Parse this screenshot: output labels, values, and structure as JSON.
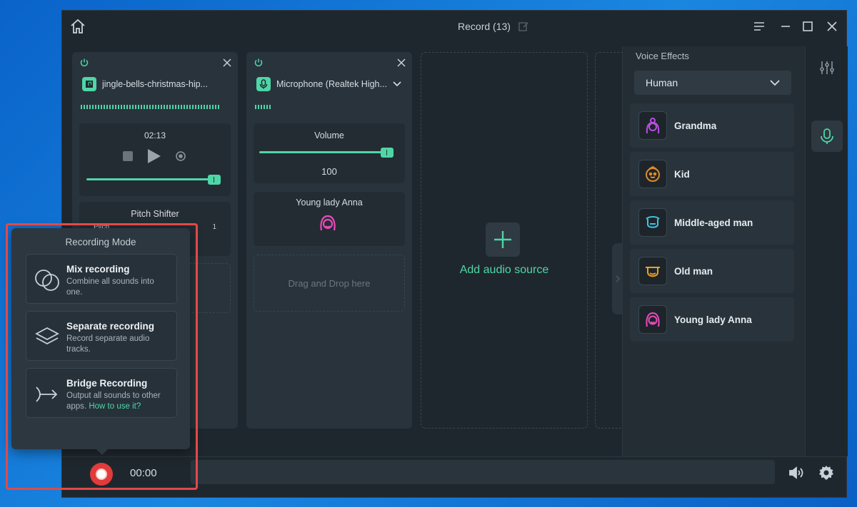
{
  "window": {
    "title": "Record (13)"
  },
  "card1": {
    "source_name": "jingle-bells-christmas-hip...",
    "time": "02:13",
    "pitch_title": "Pitch Shifter",
    "pitch_label": "Pitch",
    "pitch_value": "1"
  },
  "card2": {
    "source_name": "Microphone (Realtek High...",
    "volume_title": "Volume",
    "volume_value": "100",
    "effect_name": "Young lady Anna",
    "dropzone": "Drag and Drop here"
  },
  "add_source": {
    "label": "Add audio source"
  },
  "sidebar": {
    "title": "Voice Effects",
    "category": "Human",
    "effects": [
      {
        "label": "Grandma",
        "color": "#b84ee0"
      },
      {
        "label": "Kid",
        "color": "#e08a2a"
      },
      {
        "label": "Middle-aged man",
        "color": "#3fc4e0"
      },
      {
        "label": "Old man",
        "color": "#f0a020"
      },
      {
        "label": "Young lady Anna",
        "color": "#e84ab8"
      }
    ]
  },
  "recording_mode": {
    "title": "Recording Mode",
    "modes": [
      {
        "title": "Mix recording",
        "desc": "Combine all sounds into one."
      },
      {
        "title": "Separate recording",
        "desc": "Record separate audio tracks."
      },
      {
        "title": "Bridge Recording",
        "desc": "Output all sounds to other apps.",
        "link": "How to use it?"
      }
    ]
  },
  "bottombar": {
    "time": "00:00"
  },
  "colors": {
    "accent": "#4fd6a6",
    "record": "#e23b3b",
    "highlight": "#e04a48"
  }
}
